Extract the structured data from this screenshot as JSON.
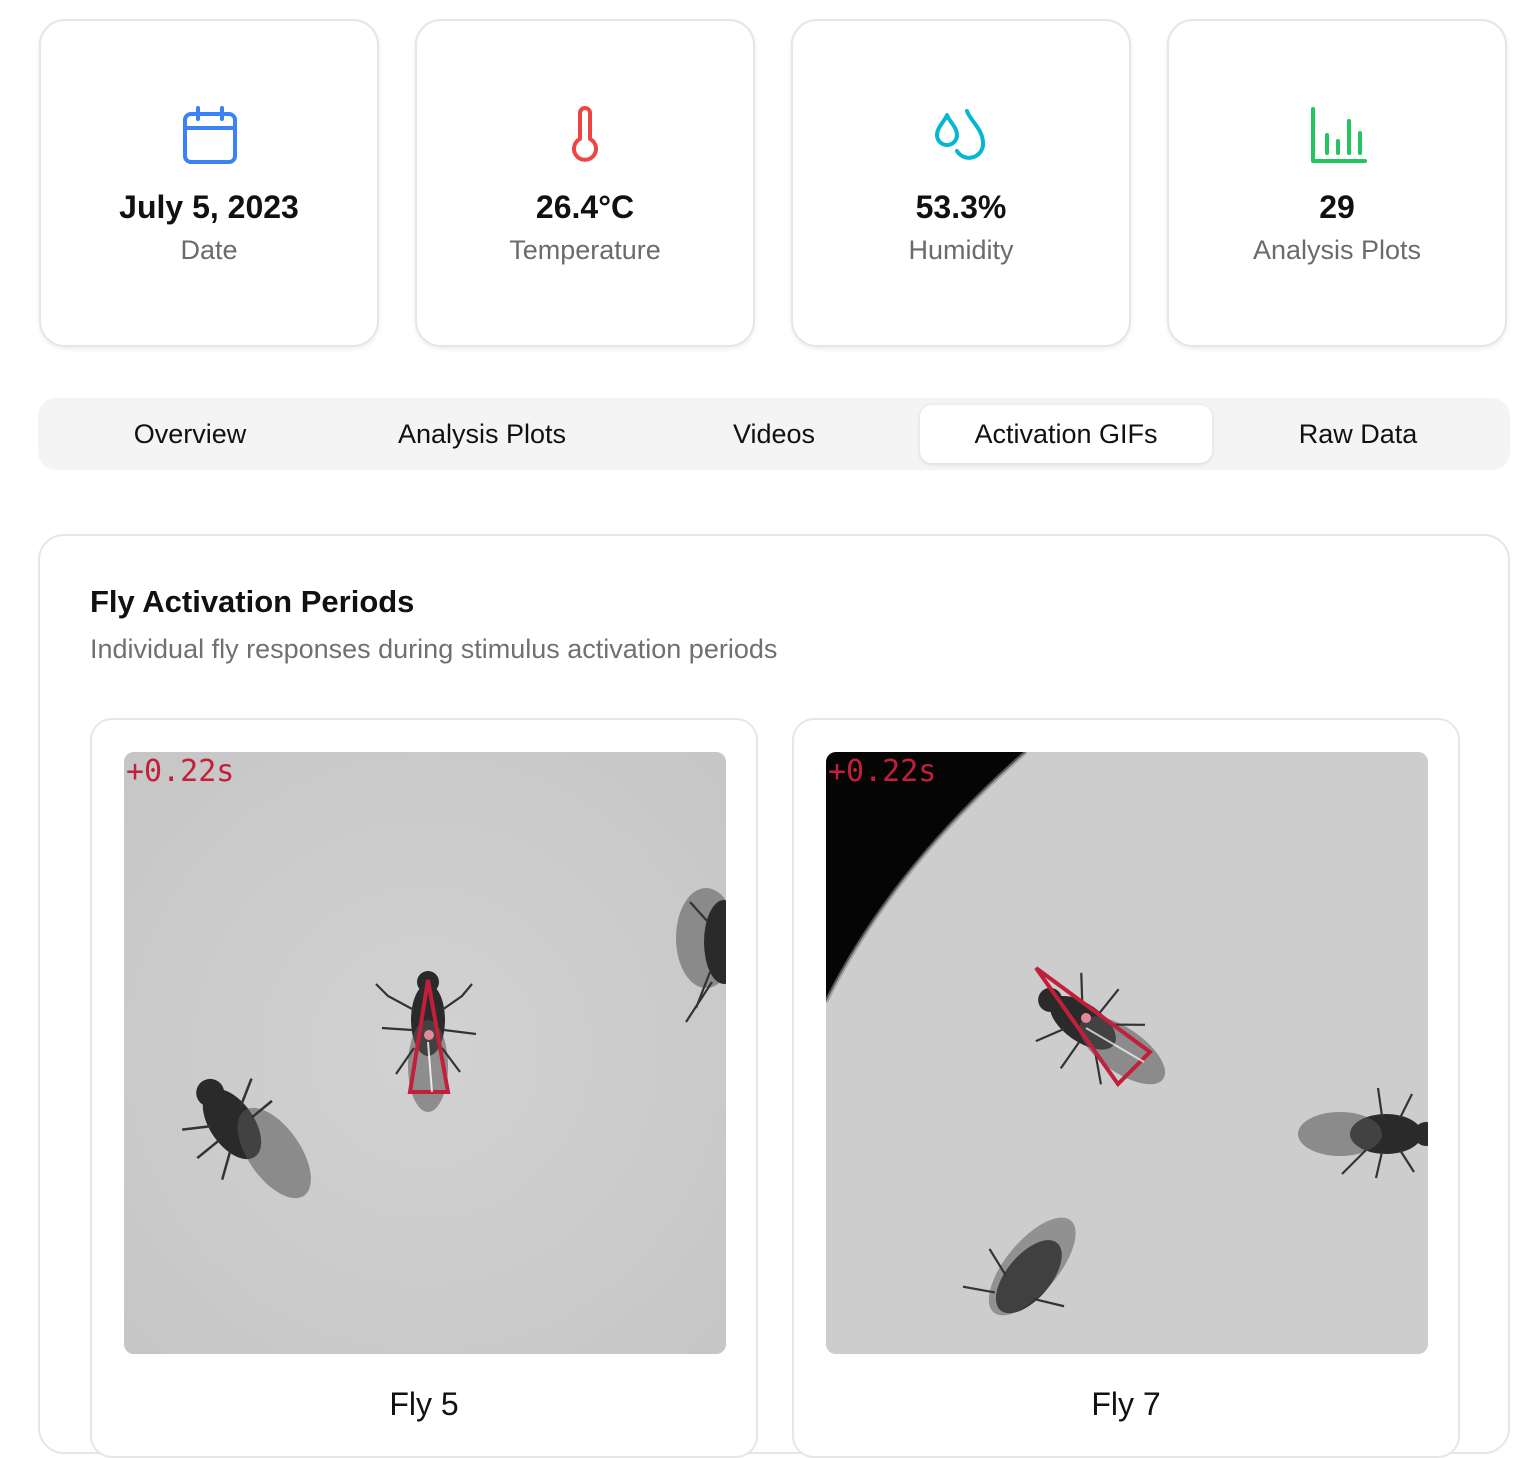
{
  "stats": [
    {
      "value": "July 5, 2023",
      "label": "Date",
      "icon": "calendar-icon",
      "color": "#3b82f6"
    },
    {
      "value": "26.4°C",
      "label": "Temperature",
      "icon": "thermometer-icon",
      "color": "#ef4444"
    },
    {
      "value": "53.3%",
      "label": "Humidity",
      "icon": "droplets-icon",
      "color": "#06b6d4"
    },
    {
      "value": "29",
      "label": "Analysis Plots",
      "icon": "bar-chart-icon",
      "color": "#22c55e"
    }
  ],
  "tabs": [
    {
      "label": "Overview",
      "active": false
    },
    {
      "label": "Analysis Plots",
      "active": false
    },
    {
      "label": "Videos",
      "active": false
    },
    {
      "label": "Activation GIFs",
      "active": true
    },
    {
      "label": "Raw Data",
      "active": false
    }
  ],
  "panel": {
    "title": "Fly Activation Periods",
    "subtitle": "Individual fly responses during stimulus activation periods",
    "gifs": [
      {
        "name": "Fly 5",
        "timestamp": "+0.22s"
      },
      {
        "name": "Fly 7",
        "timestamp": "+0.22s"
      }
    ]
  }
}
